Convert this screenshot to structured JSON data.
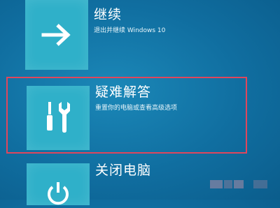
{
  "options": [
    {
      "title": "继续",
      "description": "退出并继续 Windows 10",
      "icon": "arrow-right-icon"
    },
    {
      "title": "疑难解答",
      "description": "重置你的电脑或查看高级选项",
      "icon": "tools-icon"
    },
    {
      "title": "关闭电脑",
      "description": "",
      "icon": "power-icon"
    }
  ],
  "colors": {
    "background": "#106ea0",
    "tile": "#2fb0c9",
    "highlight_border": "#e0465c"
  }
}
